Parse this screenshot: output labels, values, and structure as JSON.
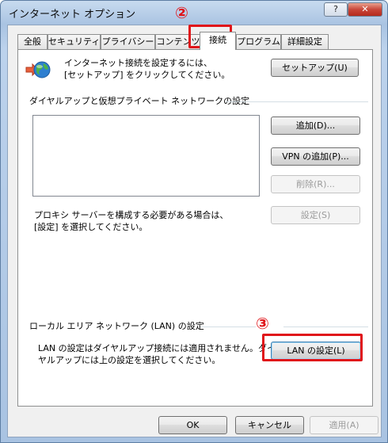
{
  "window": {
    "title": "インターネット オプション",
    "help_label": "?",
    "close_label": "✕"
  },
  "tabs": [
    {
      "label": "全般"
    },
    {
      "label": "セキュリティ"
    },
    {
      "label": "プライバシー"
    },
    {
      "label": "コンテンツ"
    },
    {
      "label": "接続",
      "active": true
    },
    {
      "label": "プログラム"
    },
    {
      "label": "詳細設定"
    }
  ],
  "connection": {
    "icon": "globe-connect-icon",
    "setup_text_line1": "インターネット接続を設定するには、",
    "setup_text_line2": "[セットアップ] をクリックしてください。",
    "setup_button": "セットアップ(U)"
  },
  "dialup": {
    "group_title": "ダイヤルアップと仮想プライベート ネットワークの設定",
    "list_items": [],
    "add_button": "追加(D)...",
    "add_vpn_button": "VPN の追加(P)...",
    "remove_button": "削除(R)...",
    "settings_button": "設定(S)",
    "proxy_text_line1": "プロキシ サーバーを構成する必要がある場合は、",
    "proxy_text_line2": "[設定] を選択してください。"
  },
  "lan": {
    "group_title": "ローカル エリア ネットワーク (LAN) の設定",
    "text_line1": "LAN の設定はダイヤルアップ接続には適用されません。ダイ",
    "text_line2": "ヤルアップには上の設定を選択してください。",
    "lan_button": "LAN の設定(L)"
  },
  "footer": {
    "ok_button": "OK",
    "cancel_button": "キャンセル",
    "apply_button": "適用(A)"
  },
  "annotations": {
    "step2": "②",
    "step3": "③",
    "color": "#e0151a"
  }
}
